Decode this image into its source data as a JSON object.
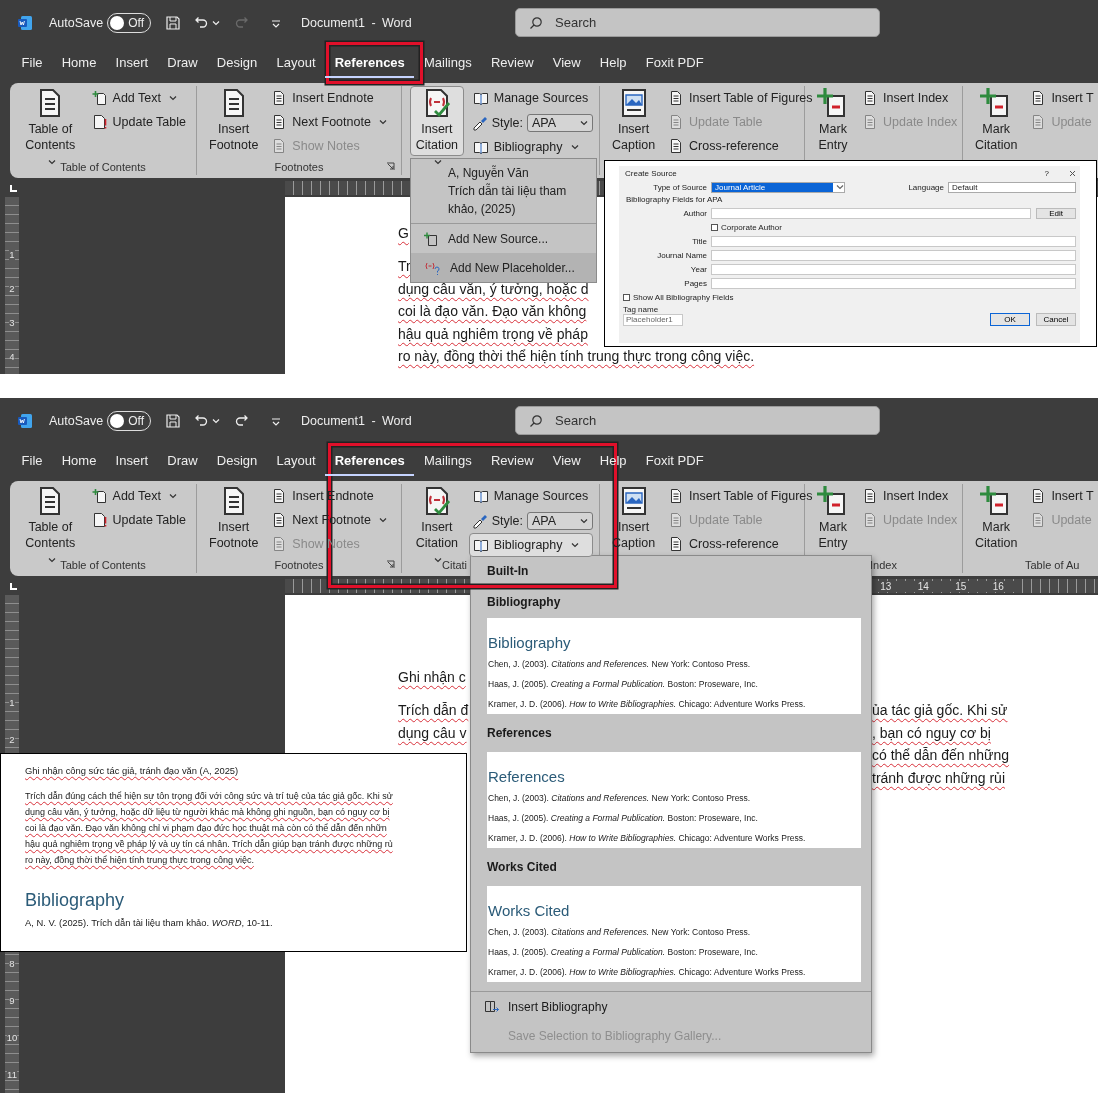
{
  "panels": [
    {
      "title_bar": {
        "autosave_label": "AutoSave",
        "autosave": {
          "label": "Off",
          "on": false
        },
        "redo_enabled": false,
        "document_title": "Document1 - Word",
        "search_placeholder": "Search"
      },
      "tabs": [
        {
          "label": "File",
          "selected": false
        },
        {
          "label": "Home",
          "selected": false
        },
        {
          "label": "Insert",
          "selected": false
        },
        {
          "label": "Draw",
          "selected": false
        },
        {
          "label": "Design",
          "selected": false
        },
        {
          "label": "Layout",
          "selected": false
        },
        {
          "label": "References",
          "selected": true
        },
        {
          "label": "Mailings",
          "selected": false
        },
        {
          "label": "Review",
          "selected": false
        },
        {
          "label": "View",
          "selected": false
        },
        {
          "label": "Help",
          "selected": false
        },
        {
          "label": "Foxit PDF",
          "selected": false
        }
      ],
      "highlight_frame": {
        "kind": "tab"
      },
      "ribbon": {
        "groups": [
          {
            "label": "Table of Contents",
            "launcher": false,
            "items": [
              {
                "kind": "large",
                "lines": [
                  "Table of",
                  "Contents"
                ],
                "caret": true,
                "disabled": false,
                "pressed": false
              },
              {
                "kind": "small",
                "label": "Add Text",
                "caret": true,
                "disabled": false,
                "pressed": false
              },
              {
                "kind": "small",
                "label": "Update Table",
                "caret": false,
                "disabled": false,
                "pressed": false
              }
            ]
          },
          {
            "label": "Footnotes",
            "launcher": true,
            "items": [
              {
                "kind": "large",
                "lines": [
                  "Insert",
                  "Footnote"
                ],
                "caret": false,
                "disabled": false,
                "pressed": false
              },
              {
                "kind": "small",
                "label": "Insert Endnote",
                "caret": false,
                "disabled": false,
                "pressed": false
              },
              {
                "kind": "small",
                "label": "Next Footnote",
                "caret": true,
                "disabled": false,
                "pressed": false
              },
              {
                "kind": "small",
                "label": "Show Notes",
                "caret": false,
                "disabled": true,
                "pressed": false
              }
            ]
          },
          {
            "launcher": false,
            "items": [
              {
                "kind": "large",
                "lines": [
                  "Insert",
                  "Citation"
                ],
                "caret": true,
                "disabled": false,
                "pressed": true
              },
              {
                "kind": "small",
                "label": "Manage Sources",
                "caret": false,
                "disabled": false,
                "pressed": false
              },
              {
                "kind": "style",
                "label": "Style:",
                "value": "APA",
                "caret": true,
                "disabled": false,
                "pressed": false
              },
              {
                "kind": "small",
                "label": "Bibliography",
                "caret": true,
                "disabled": false,
                "pressed": false
              }
            ]
          },
          {
            "launcher": false,
            "items": [
              {
                "kind": "large",
                "lines": [
                  "Insert",
                  "Caption"
                ],
                "caret": false,
                "disabled": false,
                "pressed": false
              },
              {
                "kind": "small",
                "label": "Insert Table of Figures",
                "caret": false,
                "disabled": false,
                "pressed": false
              },
              {
                "kind": "small",
                "label": "Update Table",
                "caret": false,
                "disabled": true,
                "pressed": false
              },
              {
                "kind": "small",
                "label": "Cross-reference",
                "caret": false,
                "disabled": false,
                "pressed": false
              }
            ]
          },
          {
            "launcher": false,
            "items": [
              {
                "kind": "large",
                "lines": [
                  "Mark",
                  "Entry"
                ],
                "caret": false,
                "disabled": false,
                "pressed": false
              },
              {
                "kind": "small",
                "label": "Insert Index",
                "caret": false,
                "disabled": false,
                "pressed": false
              },
              {
                "kind": "small",
                "label": "Update Index",
                "caret": false,
                "disabled": true,
                "pressed": false
              }
            ]
          },
          {
            "launcher": false,
            "items": [
              {
                "kind": "large",
                "lines": [
                  "Mark",
                  "Citation"
                ],
                "caret": false,
                "disabled": false,
                "pressed": false
              },
              {
                "kind": "small",
                "label": "Insert T",
                "caret": false,
                "disabled": false,
                "pressed": false
              },
              {
                "kind": "small",
                "label": "Update",
                "caret": false,
                "disabled": true,
                "pressed": false
              }
            ]
          }
        ]
      },
      "vertical_ruler": {
        "upper": [
          "1",
          "2",
          "3",
          "4"
        ]
      },
      "document": {
        "heading": "G",
        "rows": [
          {
            "left": "Tr"
          },
          {
            "left": "dụng câu văn, ý tưởng, hoặc d"
          },
          {
            "left": "coi là đạo văn. Đạo văn không"
          },
          {
            "left": "hậu quả nghiêm trọng về pháp"
          },
          {
            "left": "ro này, đồng thời thể hiện tính trung thực trong công việc."
          }
        ]
      },
      "citation_menu": {
        "items": [
          {
            "kind": "source",
            "lines": [
              "A, Nguyễn Văn",
              "Trích dẫn tài liệu tham",
              "khảo, (2025)"
            ]
          },
          {
            "kind": "command",
            "label": "Add New Source...",
            "highlighted": false
          },
          {
            "kind": "command",
            "label": "Add New Placeholder...",
            "highlighted": true
          }
        ]
      },
      "create_source_dialog": {
        "title": "Create Source",
        "help": "?",
        "type_of_source": {
          "label": "Type of Source",
          "value": "Journal Article"
        },
        "language": {
          "label": "Language",
          "value": "Default"
        },
        "fields_heading": "Bibliography Fields for APA",
        "fields": [
          {
            "kind": "field",
            "label": "Author",
            "button": "Edit"
          },
          {
            "kind": "checkbox",
            "label": "Corporate Author",
            "checked": false
          },
          {
            "kind": "field",
            "label": "Title"
          },
          {
            "kind": "field",
            "label": "Journal Name"
          },
          {
            "kind": "field",
            "label": "Year"
          },
          {
            "kind": "field",
            "label": "Pages"
          }
        ],
        "show_all": {
          "label": "Show All Bibliography Fields",
          "checked": false
        },
        "tag_name": {
          "label": "Tag name",
          "value": "Placeholder1"
        },
        "buttons": [
          {
            "label": "OK",
            "default": true
          },
          {
            "label": "Cancel",
            "default": false
          }
        ]
      }
    },
    {
      "title_bar": {
        "autosave_label": "AutoSave",
        "autosave": {
          "label": "Off",
          "on": false
        },
        "redo_enabled": true,
        "document_title": "Document1 - Word",
        "search_placeholder": "Search"
      },
      "tabs": [
        {
          "label": "File",
          "selected": false
        },
        {
          "label": "Home",
          "selected": false
        },
        {
          "label": "Insert",
          "selected": false
        },
        {
          "label": "Draw",
          "selected": false
        },
        {
          "label": "Design",
          "selected": false
        },
        {
          "label": "Layout",
          "selected": false
        },
        {
          "label": "References",
          "selected": true
        },
        {
          "label": "Mailings",
          "selected": false
        },
        {
          "label": "Review",
          "selected": false
        },
        {
          "label": "View",
          "selected": false
        },
        {
          "label": "Help",
          "selected": false
        },
        {
          "label": "Foxit PDF",
          "selected": false
        }
      ],
      "highlight_frame": {
        "kind": "citations"
      },
      "ribbon": {
        "groups": [
          {
            "label": "Table of Contents",
            "launcher": false,
            "items": [
              {
                "kind": "large",
                "lines": [
                  "Table of",
                  "Contents"
                ],
                "caret": true,
                "disabled": false,
                "pressed": false
              },
              {
                "kind": "small",
                "label": "Add Text",
                "caret": true,
                "disabled": false,
                "pressed": false
              },
              {
                "kind": "small",
                "label": "Update Table",
                "caret": false,
                "disabled": false,
                "pressed": false
              }
            ]
          },
          {
            "label": "Footnotes",
            "launcher": true,
            "items": [
              {
                "kind": "large",
                "lines": [
                  "Insert",
                  "Footnote"
                ],
                "caret": false,
                "disabled": false,
                "pressed": false
              },
              {
                "kind": "small",
                "label": "Insert Endnote",
                "caret": false,
                "disabled": false,
                "pressed": false
              },
              {
                "kind": "small",
                "label": "Next Footnote",
                "caret": true,
                "disabled": false,
                "pressed": false
              },
              {
                "kind": "small",
                "label": "Show Notes",
                "caret": false,
                "disabled": true,
                "pressed": false
              }
            ]
          },
          {
            "label": "Citati",
            "launcher": false,
            "items": [
              {
                "kind": "large",
                "lines": [
                  "Insert",
                  "Citation"
                ],
                "caret": true,
                "disabled": false,
                "pressed": false
              },
              {
                "kind": "small",
                "label": "Manage Sources",
                "caret": false,
                "disabled": false,
                "pressed": false
              },
              {
                "kind": "style",
                "label": "Style:",
                "value": "APA",
                "caret": true,
                "disabled": false,
                "pressed": false
              },
              {
                "kind": "small",
                "label": "Bibliography",
                "caret": true,
                "disabled": false,
                "pressed": true
              }
            ]
          },
          {
            "launcher": false,
            "items": [
              {
                "kind": "large",
                "lines": [
                  "Insert",
                  "Caption"
                ],
                "caret": false,
                "disabled": false,
                "pressed": false
              },
              {
                "kind": "small",
                "label": "Insert Table of Figures",
                "caret": false,
                "disabled": false,
                "pressed": false
              },
              {
                "kind": "small",
                "label": "Update Table",
                "caret": false,
                "disabled": true,
                "pressed": false
              },
              {
                "kind": "small",
                "label": "Cross-reference",
                "caret": false,
                "disabled": false,
                "pressed": false
              }
            ]
          },
          {
            "label": "Index",
            "launcher": false,
            "items": [
              {
                "kind": "large",
                "lines": [
                  "Mark",
                  "Entry"
                ],
                "caret": false,
                "disabled": false,
                "pressed": false
              },
              {
                "kind": "small",
                "label": "Insert Index",
                "caret": false,
                "disabled": false,
                "pressed": false
              },
              {
                "kind": "small",
                "label": "Update Index",
                "caret": false,
                "disabled": true,
                "pressed": false
              }
            ]
          },
          {
            "label": "Table of Au",
            "launcher": false,
            "items": [
              {
                "kind": "large",
                "lines": [
                  "Mark",
                  "Citation"
                ],
                "caret": false,
                "disabled": false,
                "pressed": false
              },
              {
                "kind": "small",
                "label": "Insert T",
                "caret": false,
                "disabled": false,
                "pressed": false
              },
              {
                "kind": "small",
                "label": "Update",
                "caret": false,
                "disabled": true,
                "pressed": false
              }
            ]
          }
        ]
      },
      "ruler_numbers": [
        "13",
        "14",
        "15",
        "16"
      ],
      "vertical_ruler": {
        "upper": [
          "1",
          "2"
        ],
        "lower": [
          "8",
          "9",
          "10",
          "11"
        ]
      },
      "document": {
        "heading": "Ghi nhận c",
        "rows": [
          {
            "left": "Trích dẫn đ",
            "right": "ủa tác giả gốc. Khi sử"
          },
          {
            "left": "dụng câu v",
            "right": ", bạn có nguy cơ bị"
          },
          {
            "right": "có thể dẫn đến những"
          },
          {
            "right": "tránh được những rủi"
          }
        ]
      },
      "bibliography_menu": {
        "header": "Built-In",
        "sections": [
          {
            "heading": "Bibliography",
            "preview_title": "Bibliography",
            "entries": [
              "Chen, J. (2003). *Citations and References.* New York: Contoso Press.",
              "Haas, J. (2005). *Creating a Formal Publication.* Boston: Proseware, Inc.",
              "Kramer, J. D. (2006). *How to Write Bibliographies.* Chicago: Adventure Works Press."
            ]
          },
          {
            "heading": "References",
            "preview_title": "References",
            "entries": [
              "Chen, J. (2003). *Citations and References.* New York: Contoso Press.",
              "Haas, J. (2005). *Creating a Formal Publication.* Boston: Proseware, Inc.",
              "Kramer, J. D. (2006). *How to Write Bibliographies.* Chicago: Adventure Works Press."
            ]
          },
          {
            "heading": "Works Cited",
            "preview_title": "Works Cited",
            "entries": [
              "Chen, J. (2003). *Citations and References.* New York: Contoso Press.",
              "Haas, J. (2005). *Creating a Formal Publication.* Boston: Proseware, Inc.",
              "Kramer, J. D. (2006). *How to Write Bibliographies.* Chicago: Adventure Works Press."
            ]
          }
        ],
        "commands": [
          {
            "label": "Insert Bibliography",
            "disabled": false
          },
          {
            "label": "Save Selection to Bibliography Gallery...",
            "disabled": true
          }
        ]
      },
      "doc_inset": {
        "heading": "Ghi nhận công sức tác giả, tránh đạo văn (A, 2025)",
        "lines": [
          "Trích dẫn đúng cách thể hiện sự tôn trọng đối với công sức và trí tuệ của tác giả gốc. Khi sử",
          "dụng câu văn, ý tưởng, hoặc dữ liệu từ người khác mà không ghi nguồn, bạn có nguy cơ bị",
          "coi là đạo văn. Đạo văn không chỉ vi phạm đạo đức học thuật mà còn có thể dẫn đến nhữn",
          "hậu quả nghiêm trọng về pháp lý và uy tín cá nhân. Trích dẫn giúp bạn tránh được những rủ",
          "ro này, đồng thời thể hiện tính trung thực trong công việc."
        ],
        "bibliography_title": "Bibliography",
        "bibliography_entry": "A, N. V. (2025). Trích dẫn tài liệu tham khảo. *WORD*, 10-11."
      }
    }
  ]
}
